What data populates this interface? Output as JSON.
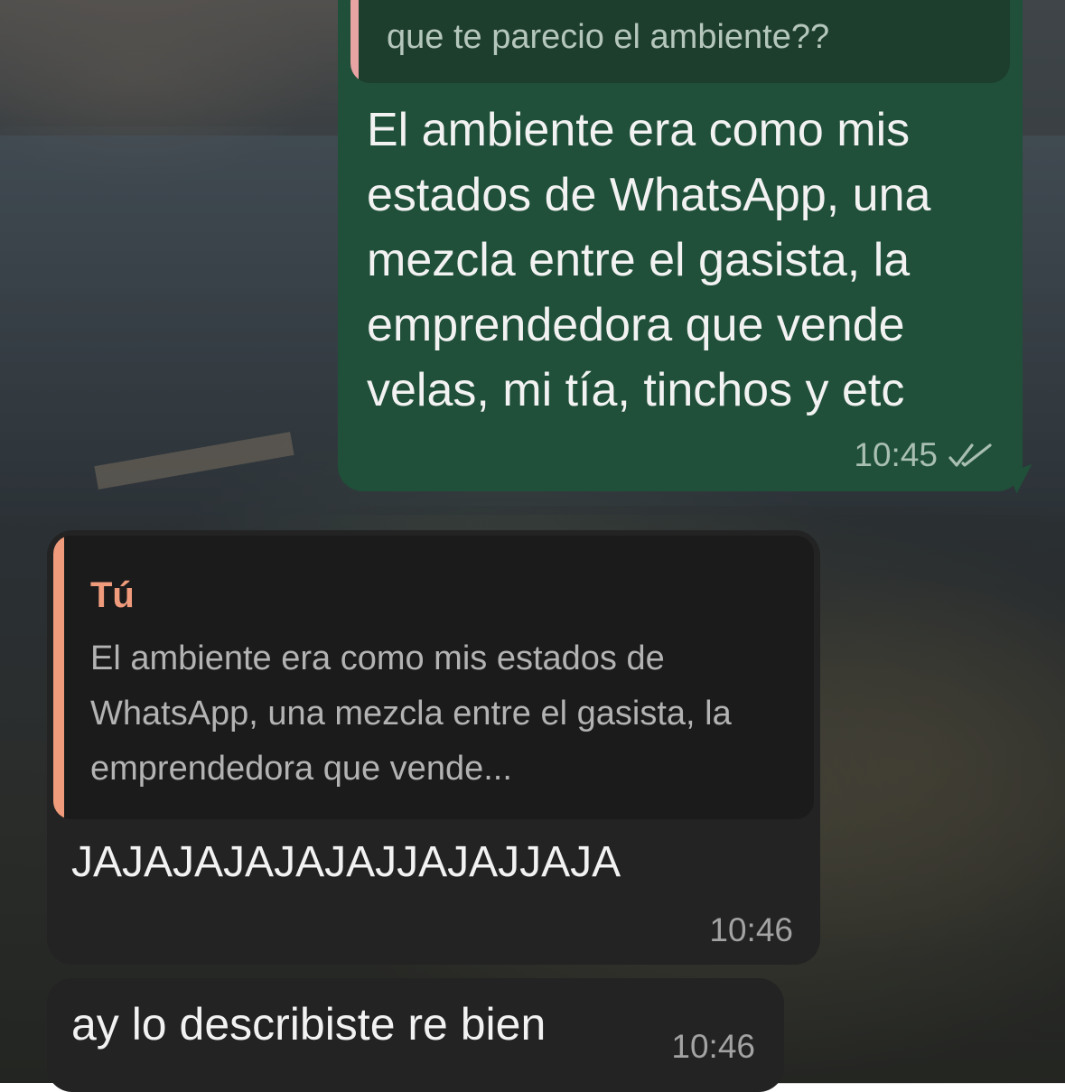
{
  "wallpaper": {
    "description_icon": "photo-wallpaper"
  },
  "messages": [
    {
      "id": "msg-outgoing",
      "direction": "outgoing",
      "quoted_text": "que te parecio el ambiente??",
      "text": "El ambiente era como mis estados de WhatsApp, una mezcla entre el gasista, la emprendedora que vende velas, mi tía, tinchos y etc",
      "time": "10:45",
      "status_icon": "double-check-icon"
    },
    {
      "id": "msg-incoming-reply",
      "direction": "incoming",
      "quoted_author": "Tú",
      "quoted_text": "El ambiente era como mis estados de WhatsApp, una mezcla entre el gasista, la emprendedora que vende...",
      "text": "JAJAJAJAJAJAJJAJAJJAJA",
      "time": "10:46"
    },
    {
      "id": "msg-incoming-2",
      "direction": "incoming",
      "text": "ay lo describiste re bien",
      "time": "10:46"
    }
  ],
  "colors": {
    "outgoing_bubble": "#205039",
    "incoming_bubble": "#232323",
    "quote_author_accent": "#ef9b7c",
    "outgoing_quote_accent": "#e8a3a3"
  }
}
